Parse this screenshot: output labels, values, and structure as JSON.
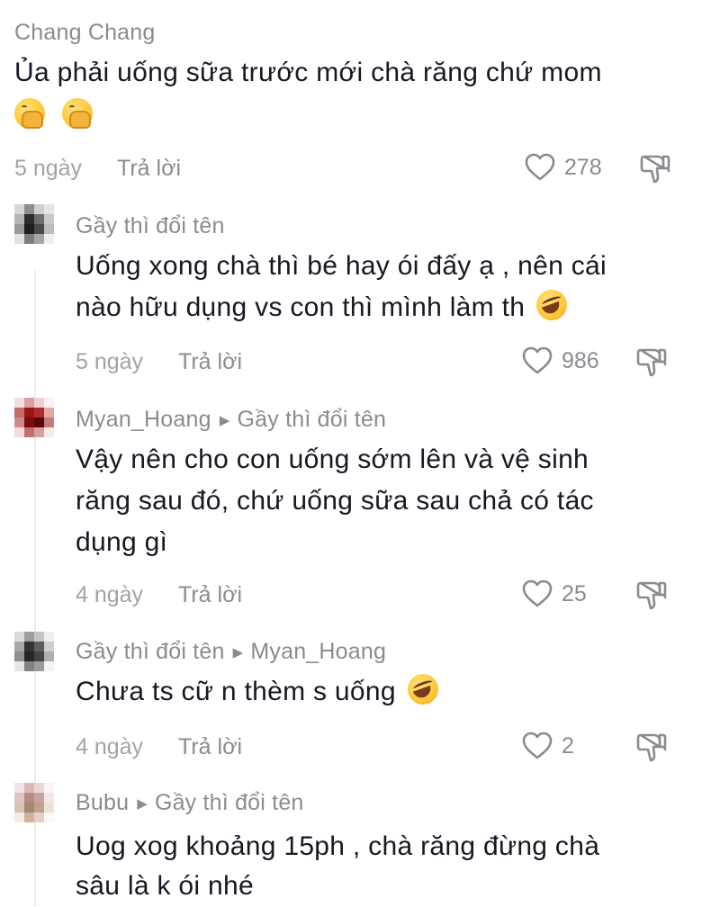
{
  "comments": [
    {
      "username": "Chang Chang",
      "text_line1": "Ủa phải uống sữa trước mới chà răng chứ mom",
      "emoji": [
        "hand-over-mouth",
        "hand-over-mouth"
      ],
      "age": "5 ngày",
      "reply_label": "Trả lời",
      "likes": "278"
    },
    {
      "username": "Gầy thì đổi tên",
      "text_line1": "Uống xong chà thì bé hay ói đấy ạ , nên cái",
      "text_line2": "nào hữu dụng vs con thì mình làm th",
      "emoji": [
        "rolling-on-floor-laughing"
      ],
      "age": "5 ngày",
      "reply_label": "Trả lời",
      "likes": "986"
    },
    {
      "username": "Myan_Hoang",
      "reply_to": "Gầy thì đổi tên",
      "text_line1": "Vậy nên cho con uống sớm lên và vệ sinh",
      "text_line2": "răng sau đó, chứ uống sữa sau chả có tác",
      "text_line3": "dụng gì",
      "age": "4 ngày",
      "reply_label": "Trả lời",
      "likes": "25"
    },
    {
      "username": "Gầy thì đổi tên",
      "reply_to": "Myan_Hoang",
      "text_line1": "Chưa ts cữ n thèm s uống",
      "emoji": [
        "rolling-on-floor-laughing"
      ],
      "age": "4 ngày",
      "reply_label": "Trả lời",
      "likes": "2"
    },
    {
      "username": "Bubu",
      "reply_to": "Gầy thì đổi tên",
      "text_line1": "Uog xog khoảng 15ph , chà răng đừng chà",
      "text_line2": "sâu là k ói nhé"
    }
  ],
  "icons": {
    "like": "heart-outline-icon",
    "dislike": "thumbs-down-outline-icon",
    "reply_arrow": "triangle-right-icon"
  },
  "colors": {
    "text": "#161823",
    "muted": "#8a8b91",
    "age": "#a2a3a8",
    "thread_line": "#ececec"
  }
}
